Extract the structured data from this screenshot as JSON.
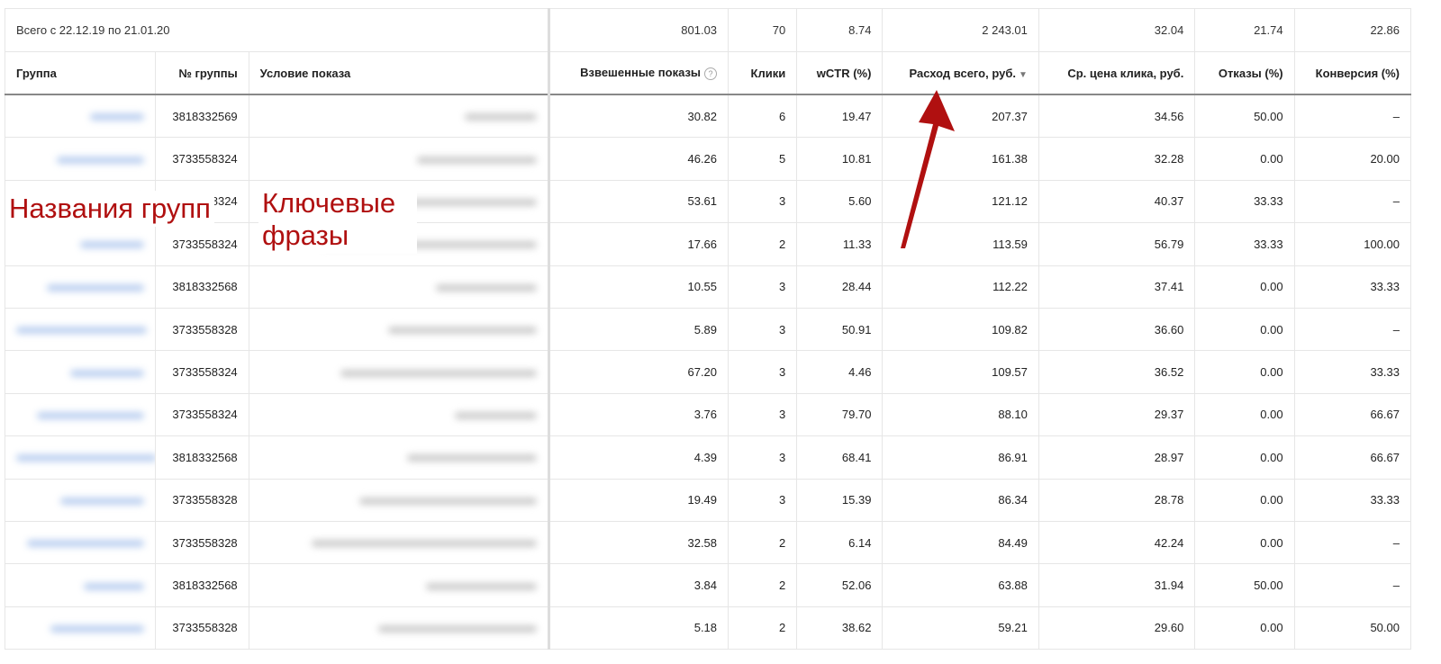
{
  "summary": {
    "label": "Всего с 22.12.19 по 21.01.20",
    "values": [
      "801.03",
      "70",
      "8.74",
      "2 243.01",
      "32.04",
      "21.74",
      "22.86"
    ]
  },
  "headers": {
    "group": "Группа",
    "group_no": "№ группы",
    "condition": "Условие показа",
    "shows": "Взвешенные показы",
    "clicks": "Клики",
    "wctr": "wCTR (%)",
    "spend": "Расход всего, руб.",
    "cpc": "Ср. цена клика, руб.",
    "bounce": "Отказы (%)",
    "conversion": "Конверсия (%)"
  },
  "help_icon": "?",
  "sort_icon": "▼",
  "rows": [
    [
      "3818332569",
      "30.82",
      "6",
      "19.47",
      "207.37",
      "34.56",
      "50.00",
      "–"
    ],
    [
      "3733558324",
      "46.26",
      "5",
      "10.81",
      "161.38",
      "32.28",
      "0.00",
      "20.00"
    ],
    [
      "3733558324",
      "53.61",
      "3",
      "5.60",
      "121.12",
      "40.37",
      "33.33",
      "–"
    ],
    [
      "3733558324",
      "17.66",
      "2",
      "11.33",
      "113.59",
      "56.79",
      "33.33",
      "100.00"
    ],
    [
      "3818332568",
      "10.55",
      "3",
      "28.44",
      "112.22",
      "37.41",
      "0.00",
      "33.33"
    ],
    [
      "3733558328",
      "5.89",
      "3",
      "50.91",
      "109.82",
      "36.60",
      "0.00",
      "–"
    ],
    [
      "3733558324",
      "67.20",
      "3",
      "4.46",
      "109.57",
      "36.52",
      "0.00",
      "33.33"
    ],
    [
      "3733558324",
      "3.76",
      "3",
      "79.70",
      "88.10",
      "29.37",
      "0.00",
      "66.67"
    ],
    [
      "3818332568",
      "4.39",
      "3",
      "68.41",
      "86.91",
      "28.97",
      "0.00",
      "66.67"
    ],
    [
      "3733558328",
      "19.49",
      "3",
      "15.39",
      "86.34",
      "28.78",
      "0.00",
      "33.33"
    ],
    [
      "3733558328",
      "32.58",
      "2",
      "6.14",
      "84.49",
      "42.24",
      "0.00",
      "–"
    ],
    [
      "3818332568",
      "3.84",
      "2",
      "52.06",
      "63.88",
      "31.94",
      "50.00",
      "–"
    ],
    [
      "3733558328",
      "5.18",
      "2",
      "38.62",
      "59.21",
      "29.60",
      "0.00",
      "50.00"
    ]
  ],
  "annotations": {
    "groups": "Названия групп",
    "keywords": "Ключевые фразы"
  },
  "colors": {
    "annotation": "#b01010"
  }
}
